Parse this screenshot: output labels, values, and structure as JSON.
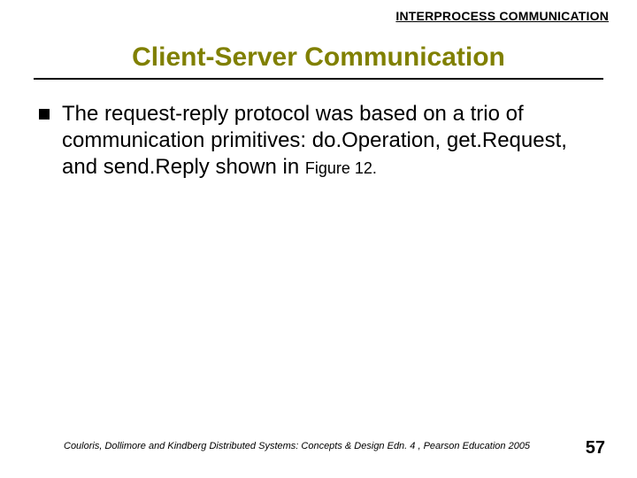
{
  "header": {
    "label": "INTERPROCESS COMMUNICATION"
  },
  "title": "Client-Server Communication",
  "bullets": [
    {
      "text": "The request-reply protocol was based on a trio of communication primitives: do.Operation, get.Request, and send.Reply shown in ",
      "figure_ref": "Figure 12."
    }
  ],
  "footer": {
    "citation": "Couloris, Dollimore and Kindberg  Distributed Systems: Concepts & Design  Edn. 4 , Pearson Education 2005",
    "page": "57"
  }
}
